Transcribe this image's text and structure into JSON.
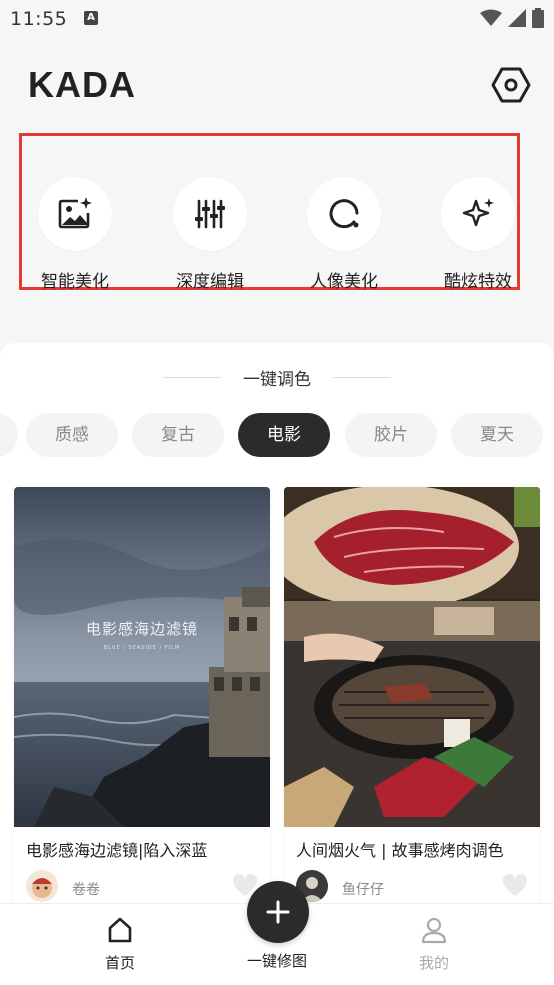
{
  "status": {
    "time": "11:55",
    "indicator": "A"
  },
  "header": {
    "logo": "KADA",
    "settings_icon": "hexagon-settings-icon"
  },
  "tools": [
    {
      "label": "智能美化",
      "icon": "image-sparkle-icon"
    },
    {
      "label": "深度编辑",
      "icon": "sliders-icon"
    },
    {
      "label": "人像美化",
      "icon": "portrait-circle-icon"
    },
    {
      "label": "酷炫特效",
      "icon": "sparkle-icon"
    }
  ],
  "section": {
    "title": "一键调色"
  },
  "chips": [
    "质感",
    "复古",
    "电影",
    "胶片",
    "夏天"
  ],
  "active_chip": "电影",
  "cards": [
    {
      "overlay_title": "电影感海边滤镜",
      "overlay_sub": "BLUE / SEASIDE / FILM",
      "title": "电影感海边滤镜|陷入深蓝",
      "author": "卷卷"
    },
    {
      "title": "人间烟火气 | 故事感烤肉调色",
      "author": "鱼仔仔"
    }
  ],
  "bottom_nav": {
    "home": "首页",
    "center": "一键修图",
    "profile": "我的"
  },
  "colors": {
    "accent_dark": "#2b2b2b",
    "highlight_border": "#e53935",
    "background": "#f6f6f6"
  }
}
